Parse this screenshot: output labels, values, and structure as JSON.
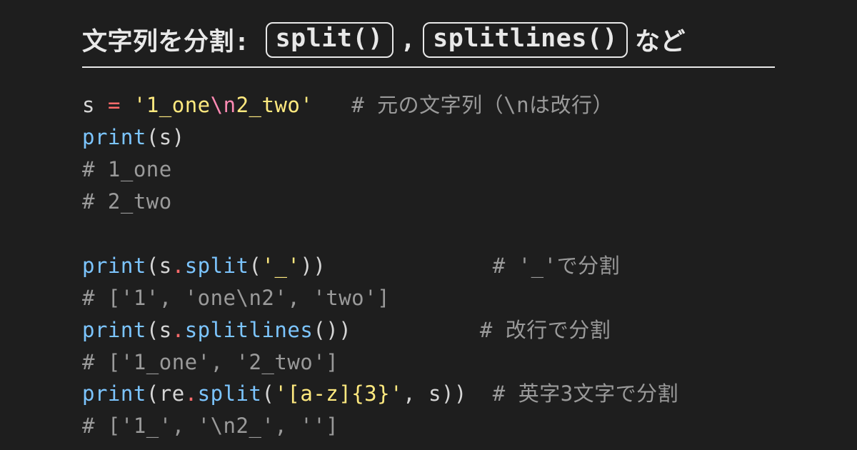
{
  "title": {
    "prefix": "文字列を分割:",
    "box1": "split()",
    "comma": ",",
    "box2": "splitlines()",
    "suffix": "など"
  },
  "code": {
    "l1": {
      "var": "s",
      "op": "=",
      "str_a": "'1_one",
      "esc": "\\n",
      "str_b": "2_two'",
      "cmt": "# 元の文字列（\\nは改行）"
    },
    "l2": {
      "fn": "print",
      "p1": "(",
      "arg": "s",
      "p2": ")"
    },
    "l3": {
      "cmt": "# 1_one"
    },
    "l4": {
      "cmt": "# 2_two"
    },
    "l6": {
      "fn": "print",
      "p1": "(",
      "obj": "s",
      "dot": ".",
      "call": "split",
      "p2": "(",
      "arg": "'_'",
      "p3": "))",
      "pad": "             ",
      "cmt": "# '_'で分割"
    },
    "l7": {
      "cmt": "# ['1', 'one\\n2', 'two']"
    },
    "l8": {
      "fn": "print",
      "p1": "(",
      "obj": "s",
      "dot": ".",
      "call": "splitlines",
      "p2": "())",
      "pad": "          ",
      "cmt": "# 改行で分割"
    },
    "l9": {
      "cmt": "# ['1_one', '2_two']"
    },
    "l10": {
      "fn": "print",
      "p1": "(",
      "obj": "re",
      "dot": ".",
      "call": "split",
      "p2": "(",
      "arg1": "'[a-z]{3}'",
      "sep": ", ",
      "arg2": "s",
      "p3": "))",
      "pad": "  ",
      "cmt": "# 英字3文字で分割"
    },
    "l11": {
      "cmt": "# ['1_', '\\n2_', '']"
    }
  }
}
